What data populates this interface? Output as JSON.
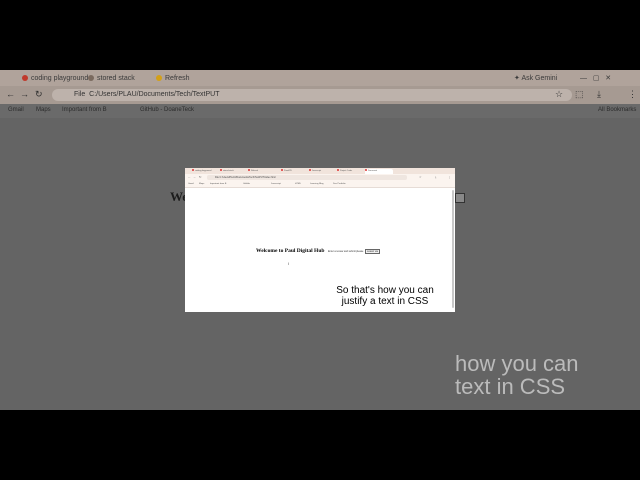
{
  "background_browser": {
    "tabs": [
      {
        "label": "coding playground",
        "icon": "pinterest-icon",
        "color": "#c0392b"
      },
      {
        "label": "stored stack",
        "icon": "tab-icon",
        "color": "#7a6a5f"
      },
      {
        "label": "Refresh",
        "icon": "tab-icon",
        "color": "#d4a017"
      }
    ],
    "ask_button": "Ask Gemini",
    "url": "C:/Users/PLAU/Documents/Tech/TextPUT",
    "file_label": "File",
    "bookmarks": [
      "Gmail",
      "Maps",
      "Important from B",
      "GitHub - DoaneTeck",
      "All Bookmarks"
    ],
    "heading_fragment": "We",
    "caption_fragment_line1": "how you can",
    "caption_fragment_line2": "text in CSS"
  },
  "capture": {
    "tabs": [
      {
        "label": "coding playground"
      },
      {
        "label": "stored stack"
      },
      {
        "label": "Refresh"
      },
      {
        "label": "PanelPD"
      },
      {
        "label": "Javascript"
      },
      {
        "label": "Project Cards"
      },
      {
        "label": "Document"
      }
    ],
    "url": "C:/Users/PLAU/Documents/Tech/TextPUT/index.html",
    "file_label": "File",
    "bookmarks": [
      "Gmail",
      "Maps",
      "Important from B",
      "GitHub",
      "Javascript",
      "HTML",
      "Learning Blog",
      "Dev Portfolio"
    ],
    "heading": "Welcome to Paul Digital Hub",
    "small_text": "Enter a review and submit please",
    "button_label": "SUBMIT ME"
  },
  "caption": {
    "line1": "So that's how you can",
    "line2": "justify a text in CSS"
  }
}
